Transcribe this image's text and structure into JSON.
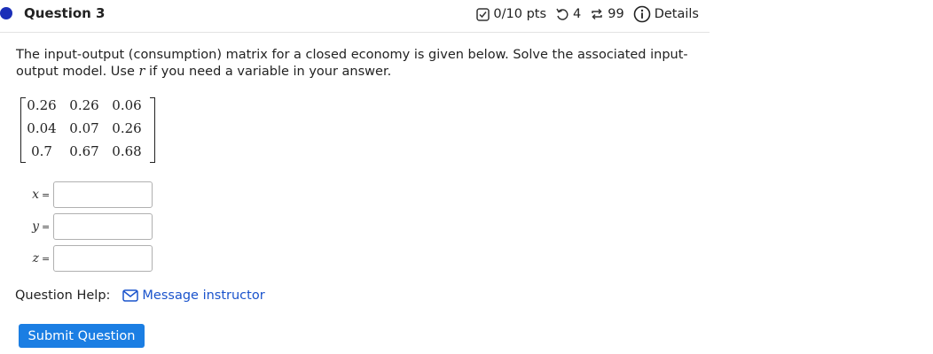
{
  "question": {
    "title": "Question 3",
    "score": "0/10 pts",
    "retries": "4",
    "attempts": "99",
    "details_label": "Details"
  },
  "prompt": {
    "text_1": "The input-output (consumption) matrix for a closed economy is given below. Solve the associated input-",
    "text_2a": "output model. Use ",
    "variable": "r",
    "text_2b": " if you need a variable in your answer."
  },
  "matrix": [
    [
      "0.26",
      "0.26",
      "0.06"
    ],
    [
      "0.04",
      "0.07",
      "0.26"
    ],
    [
      "0.7",
      "0.67",
      "0.68"
    ]
  ],
  "answers": [
    {
      "var": "x",
      "eq": "=",
      "value": ""
    },
    {
      "var": "y",
      "eq": "=",
      "value": ""
    },
    {
      "var": "z",
      "eq": "=",
      "value": ""
    }
  ],
  "help": {
    "label": "Question Help:",
    "link_text": "Message instructor"
  },
  "submit_label": "Submit Question",
  "colors": {
    "accent": "#1b2fb8",
    "link": "#1a53cc",
    "button": "#1b7ee3"
  },
  "icons": {
    "score": "checkbox-icon",
    "retries": "undo-icon",
    "attempts": "repeat-icon",
    "details": "info-icon",
    "message": "envelope-icon"
  }
}
